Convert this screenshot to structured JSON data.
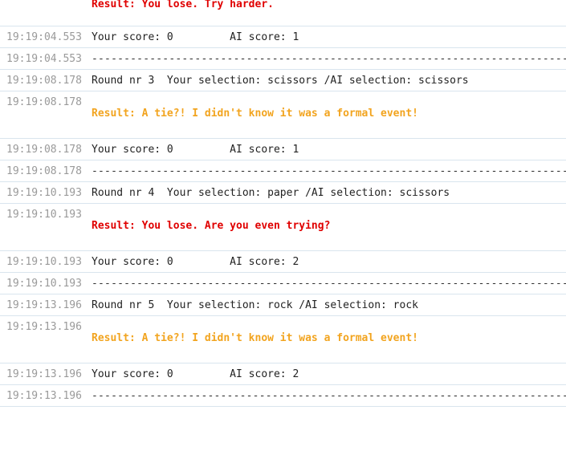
{
  "colors": {
    "timestamp": "#9a9a9a",
    "lose": "#e00000",
    "tie": "#f2a41f",
    "text": "#222222",
    "divider": "#d9e5ee"
  },
  "log": [
    {
      "ts": "19:19:04.553",
      "kind": "result",
      "text": "Result: You lose. Try harder.",
      "variant": "lose",
      "first": true
    },
    {
      "ts": "19:19:04.553",
      "kind": "plain",
      "text": "Your score: 0         AI score: 1"
    },
    {
      "ts": "19:19:04.553",
      "kind": "separator",
      "text": "----------------------------------------------------------------------------------"
    },
    {
      "ts": "19:19:08.178",
      "kind": "plain",
      "text": "Round nr 3  Your selection: scissors /AI selection: scissors"
    },
    {
      "ts": "19:19:08.178",
      "kind": "result",
      "text": "Result: A tie?! I didn't know it was a formal event!",
      "variant": "tie"
    },
    {
      "ts": "19:19:08.178",
      "kind": "plain",
      "text": "Your score: 0         AI score: 1"
    },
    {
      "ts": "19:19:08.178",
      "kind": "separator",
      "text": "----------------------------------------------------------------------------------"
    },
    {
      "ts": "19:19:10.193",
      "kind": "plain",
      "text": "Round nr 4  Your selection: paper /AI selection: scissors"
    },
    {
      "ts": "19:19:10.193",
      "kind": "result",
      "text": "Result: You lose. Are you even trying?",
      "variant": "lose"
    },
    {
      "ts": "19:19:10.193",
      "kind": "plain",
      "text": "Your score: 0         AI score: 2"
    },
    {
      "ts": "19:19:10.193",
      "kind": "separator",
      "text": "----------------------------------------------------------------------------------"
    },
    {
      "ts": "19:19:13.196",
      "kind": "plain",
      "text": "Round nr 5  Your selection: rock /AI selection: rock"
    },
    {
      "ts": "19:19:13.196",
      "kind": "result",
      "text": "Result: A tie?! I didn't know it was a formal event!",
      "variant": "tie"
    },
    {
      "ts": "19:19:13.196",
      "kind": "plain",
      "text": "Your score: 0         AI score: 2"
    },
    {
      "ts": "19:19:13.196",
      "kind": "separator",
      "text": "----------------------------------------------------------------------------------"
    }
  ]
}
